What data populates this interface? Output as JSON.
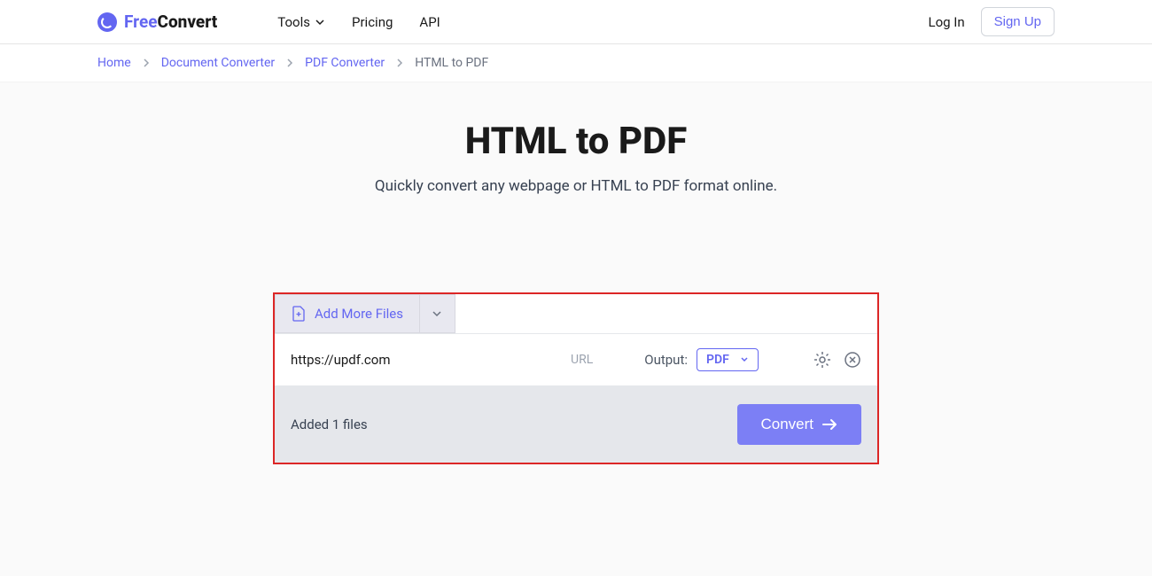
{
  "header": {
    "logo_free": "Free",
    "logo_convert": "Convert",
    "nav": {
      "tools": "Tools",
      "pricing": "Pricing",
      "api": "API"
    },
    "login": "Log In",
    "signup": "Sign Up"
  },
  "breadcrumb": {
    "home": "Home",
    "doc_converter": "Document Converter",
    "pdf_converter": "PDF Converter",
    "current": "HTML to PDF"
  },
  "page": {
    "title": "HTML to PDF",
    "subtitle": "Quickly convert any webpage or HTML to PDF format online."
  },
  "converter": {
    "add_files": "Add More Files",
    "file_url": "https://updf.com",
    "file_type": "URL",
    "output_label": "Output:",
    "output_value": "PDF",
    "added_text": "Added 1 files",
    "convert_button": "Convert"
  }
}
